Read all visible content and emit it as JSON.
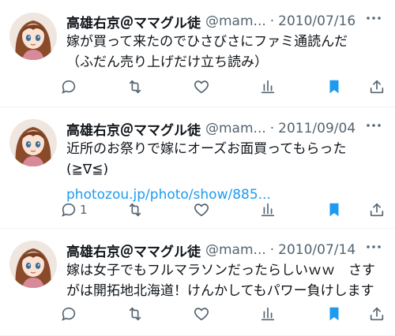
{
  "colors": {
    "text": "#0f1419",
    "secondary": "#536471",
    "link": "#1d9bf0",
    "bookmark": "#1d9bf0",
    "divider": "#eff3f4"
  },
  "tweets": [
    {
      "display_name": "高雄右京＠ママグル徒",
      "handle": "@mam...",
      "separator": "·",
      "date": "2010/07/16",
      "text_lines": [
        "嫁が買って来たのでひさびさにファミ通読んだ",
        "（ふだん売り上げだけ立ち読み）"
      ],
      "link": "",
      "reply_count": "",
      "icons": [
        "reply-icon",
        "retweet-icon",
        "like-icon",
        "views-icon",
        "bookmark-icon",
        "share-icon"
      ]
    },
    {
      "display_name": "高雄右京＠ママグル徒",
      "handle": "@mam...",
      "separator": "·",
      "date": "2011/09/04",
      "text_lines": [
        "近所のお祭りで嫁にオーズお面買ってもらった",
        "(≧∇≦)"
      ],
      "link": "photozou.jp/photo/show/885...",
      "reply_count": "1",
      "icons": [
        "reply-icon",
        "retweet-icon",
        "like-icon",
        "views-icon",
        "bookmark-icon",
        "share-icon"
      ]
    },
    {
      "display_name": "高雄右京＠ママグル徒",
      "handle": "@mam...",
      "separator": "·",
      "date": "2010/07/14",
      "text_lines": [
        "嫁は女子でもフルマラソンだったらしいｗｗ　さす",
        "がは開拓地北海道！けんかしてもパワー負けします"
      ],
      "link": "",
      "reply_count": "",
      "icons": [
        "reply-icon",
        "retweet-icon",
        "like-icon",
        "views-icon",
        "bookmark-icon",
        "share-icon"
      ]
    }
  ]
}
